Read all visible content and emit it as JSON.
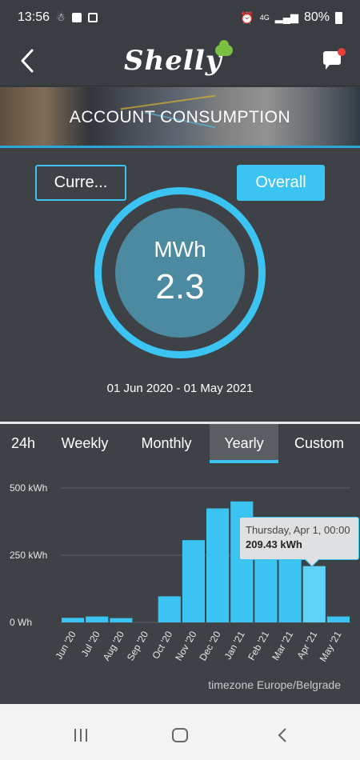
{
  "status_bar": {
    "time": "13:56",
    "battery": "80%",
    "network": "4G"
  },
  "header": {
    "logo_text": "Shelly",
    "back_icon": "chevron-left-icon",
    "chat_icon": "chat-bubble-icon"
  },
  "banner": {
    "title": "ACCOUNT CONSUMPTION"
  },
  "summary": {
    "current_label": "Curre...",
    "overall_label": "Overall",
    "unit": "MWh",
    "value": "2.3",
    "date_range": "01 Jun 2020 - 01 May 2021"
  },
  "tabs": [
    {
      "label": "24h",
      "active": false
    },
    {
      "label": "Weekly",
      "active": false
    },
    {
      "label": "Monthly",
      "active": false
    },
    {
      "label": "Yearly",
      "active": true
    },
    {
      "label": "Custom",
      "active": false
    }
  ],
  "tooltip": {
    "date": "Thursday, Apr 1, 00:00",
    "value": "209.43 kWh"
  },
  "timezone": "timezone Europe/Belgrade",
  "colors": {
    "accent": "#3bc3f2",
    "bar": "#3bc3f2",
    "bar_highlight": "#5fd2f7",
    "gauge_inner": "#4b8aa0"
  },
  "chart_data": {
    "type": "bar",
    "categories": [
      "Jun '20",
      "Jul '20",
      "Aug '20",
      "Sep '20",
      "Oct '20",
      "Nov '20",
      "Dec '20",
      "Jan '21",
      "Feb '21",
      "Mar '21",
      "Apr '21",
      "May '21"
    ],
    "values": [
      17,
      22,
      16,
      0,
      97,
      306,
      424,
      450,
      310,
      275,
      209.43,
      22
    ],
    "y_ticks": [
      "0 Wh",
      "250 kWh",
      "500 kWh"
    ],
    "y_tick_values": [
      0,
      250,
      500
    ],
    "ylim": [
      0,
      500
    ],
    "grid": true,
    "highlight_index": 10
  },
  "nav": {
    "recents_icon": "recents-icon",
    "home_icon": "home-icon",
    "back_icon": "back-icon"
  }
}
